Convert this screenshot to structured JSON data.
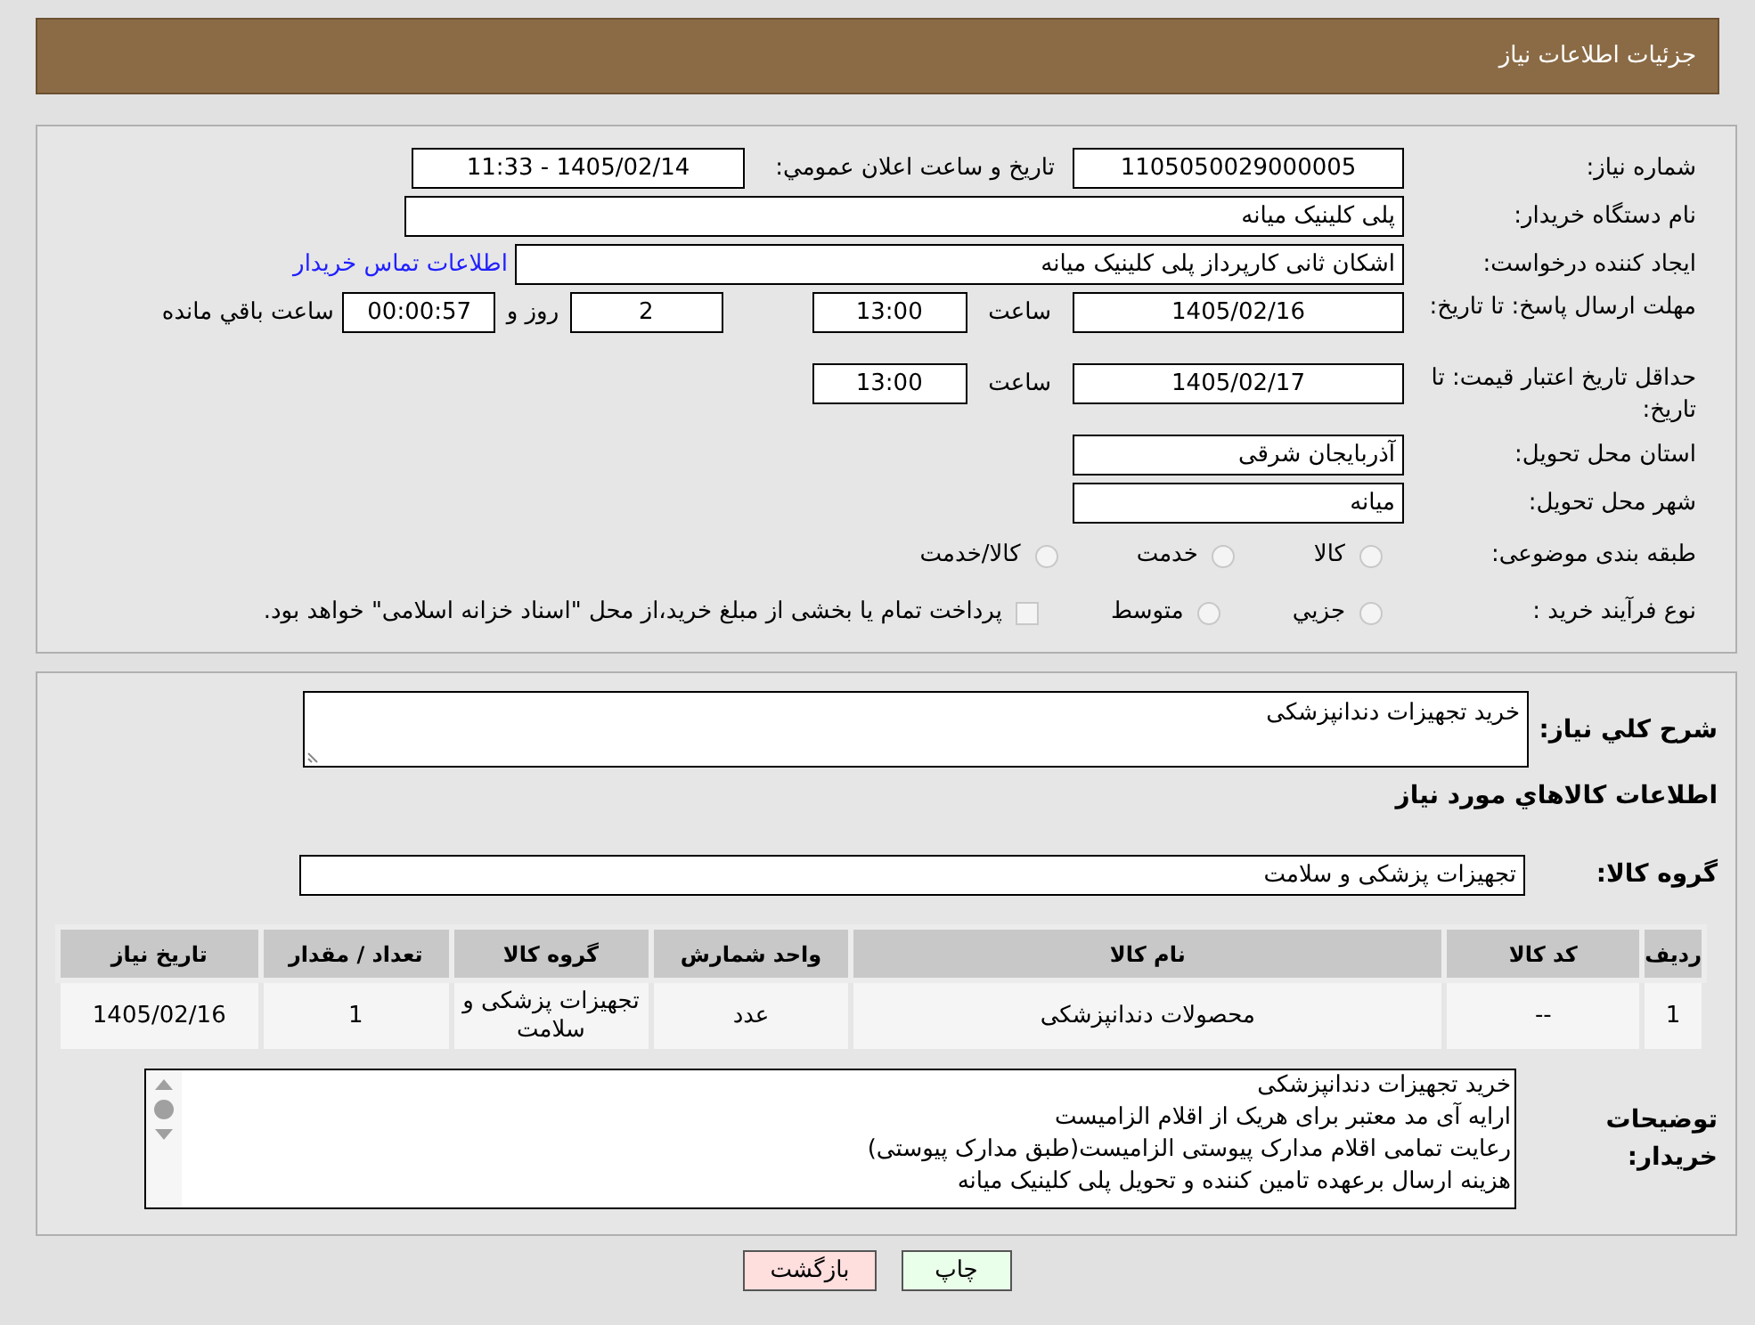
{
  "header": {
    "title": "جزئیات اطلاعات نیاز"
  },
  "need_number": {
    "label": "شماره نیاز:",
    "value": "1105050029000005"
  },
  "announce": {
    "label": "تاریخ و ساعت اعلان عمومي:",
    "value": "1405/02/14 - 11:33"
  },
  "buyer": {
    "label": "نام دستگاه خریدار:",
    "value": "پلی کلینیک میانه"
  },
  "creator": {
    "label": "ایجاد کننده درخواست:",
    "value": "اشکان ثانی کارپرداز پلی کلینیک میانه",
    "link": "اطلاعات تماس خریدار"
  },
  "deadline": {
    "label": "مهلت ارسال پاسخ: تا تاریخ:",
    "date": "1405/02/16",
    "time_label": "ساعت",
    "time": "13:00",
    "days": "2",
    "days_label": "روز و",
    "remaining": "00:00:57",
    "remaining_label": "ساعت باقي مانده"
  },
  "validity": {
    "label": "حداقل تاریخ اعتبار قیمت: تا تاریخ:",
    "date": "1405/02/17",
    "time_label": "ساعت",
    "time": "13:00"
  },
  "province": {
    "label": "استان محل تحویل:",
    "value": "آذربایجان شرقی"
  },
  "city": {
    "label": "شهر محل تحویل:",
    "value": "میانه"
  },
  "category": {
    "label": "طبقه بندی موضوعی:",
    "options": [
      {
        "label": "کالا",
        "selected": false
      },
      {
        "label": "خدمت",
        "selected": false
      },
      {
        "label": "کالا/خدمت",
        "selected": false
      }
    ]
  },
  "purchase_type": {
    "label": "نوع فرآیند خرید :",
    "options": [
      {
        "kind": "radio",
        "label": "جزیي",
        "selected": false
      },
      {
        "kind": "radio",
        "label": "متوسط",
        "selected": false
      },
      {
        "kind": "checkbox",
        "label": "پرداخت تمام یا بخشی از مبلغ خرید،از محل \"اسناد خزانه اسلامی\" خواهد بود.",
        "checked": false
      }
    ]
  },
  "summary": {
    "label": "شرح کلي نیاز:",
    "value": "خرید تجهیزات دندانپزشکی"
  },
  "goods_title": "اطلاعات کالاهاي مورد نیاز",
  "goods_group": {
    "label": "گروه کالا:",
    "value": "تجهیزات پزشکی و سلامت"
  },
  "table": {
    "columns": [
      "ردیف",
      "کد کالا",
      "نام کالا",
      "واحد شمارش",
      "گروه کالا",
      "تعداد / مقدار",
      "تاریخ نیاز"
    ],
    "rows": [
      [
        "1",
        "--",
        "محصولات دندانپزشکی",
        "عدد",
        "تجهیزات پزشکی و سلامت",
        "1",
        "1405/02/16"
      ]
    ]
  },
  "buyer_notes": {
    "label": "توضیحات خریدار:",
    "lines": [
      "خرید تجهیزات دندانپزشکی",
      "ارایه آی مد معتبر برای هریک از اقلام الزامیست",
      "رعایت تمامی اقلام مدارک پیوستی الزامیست(طبق مدارک پیوستی)",
      "هزینه ارسال برعهده تامین کننده و تحویل پلی کلینیک میانه"
    ]
  },
  "buttons": [
    {
      "kind": "print",
      "label": "چاپ"
    },
    {
      "kind": "back",
      "label": "بازگشت"
    }
  ]
}
